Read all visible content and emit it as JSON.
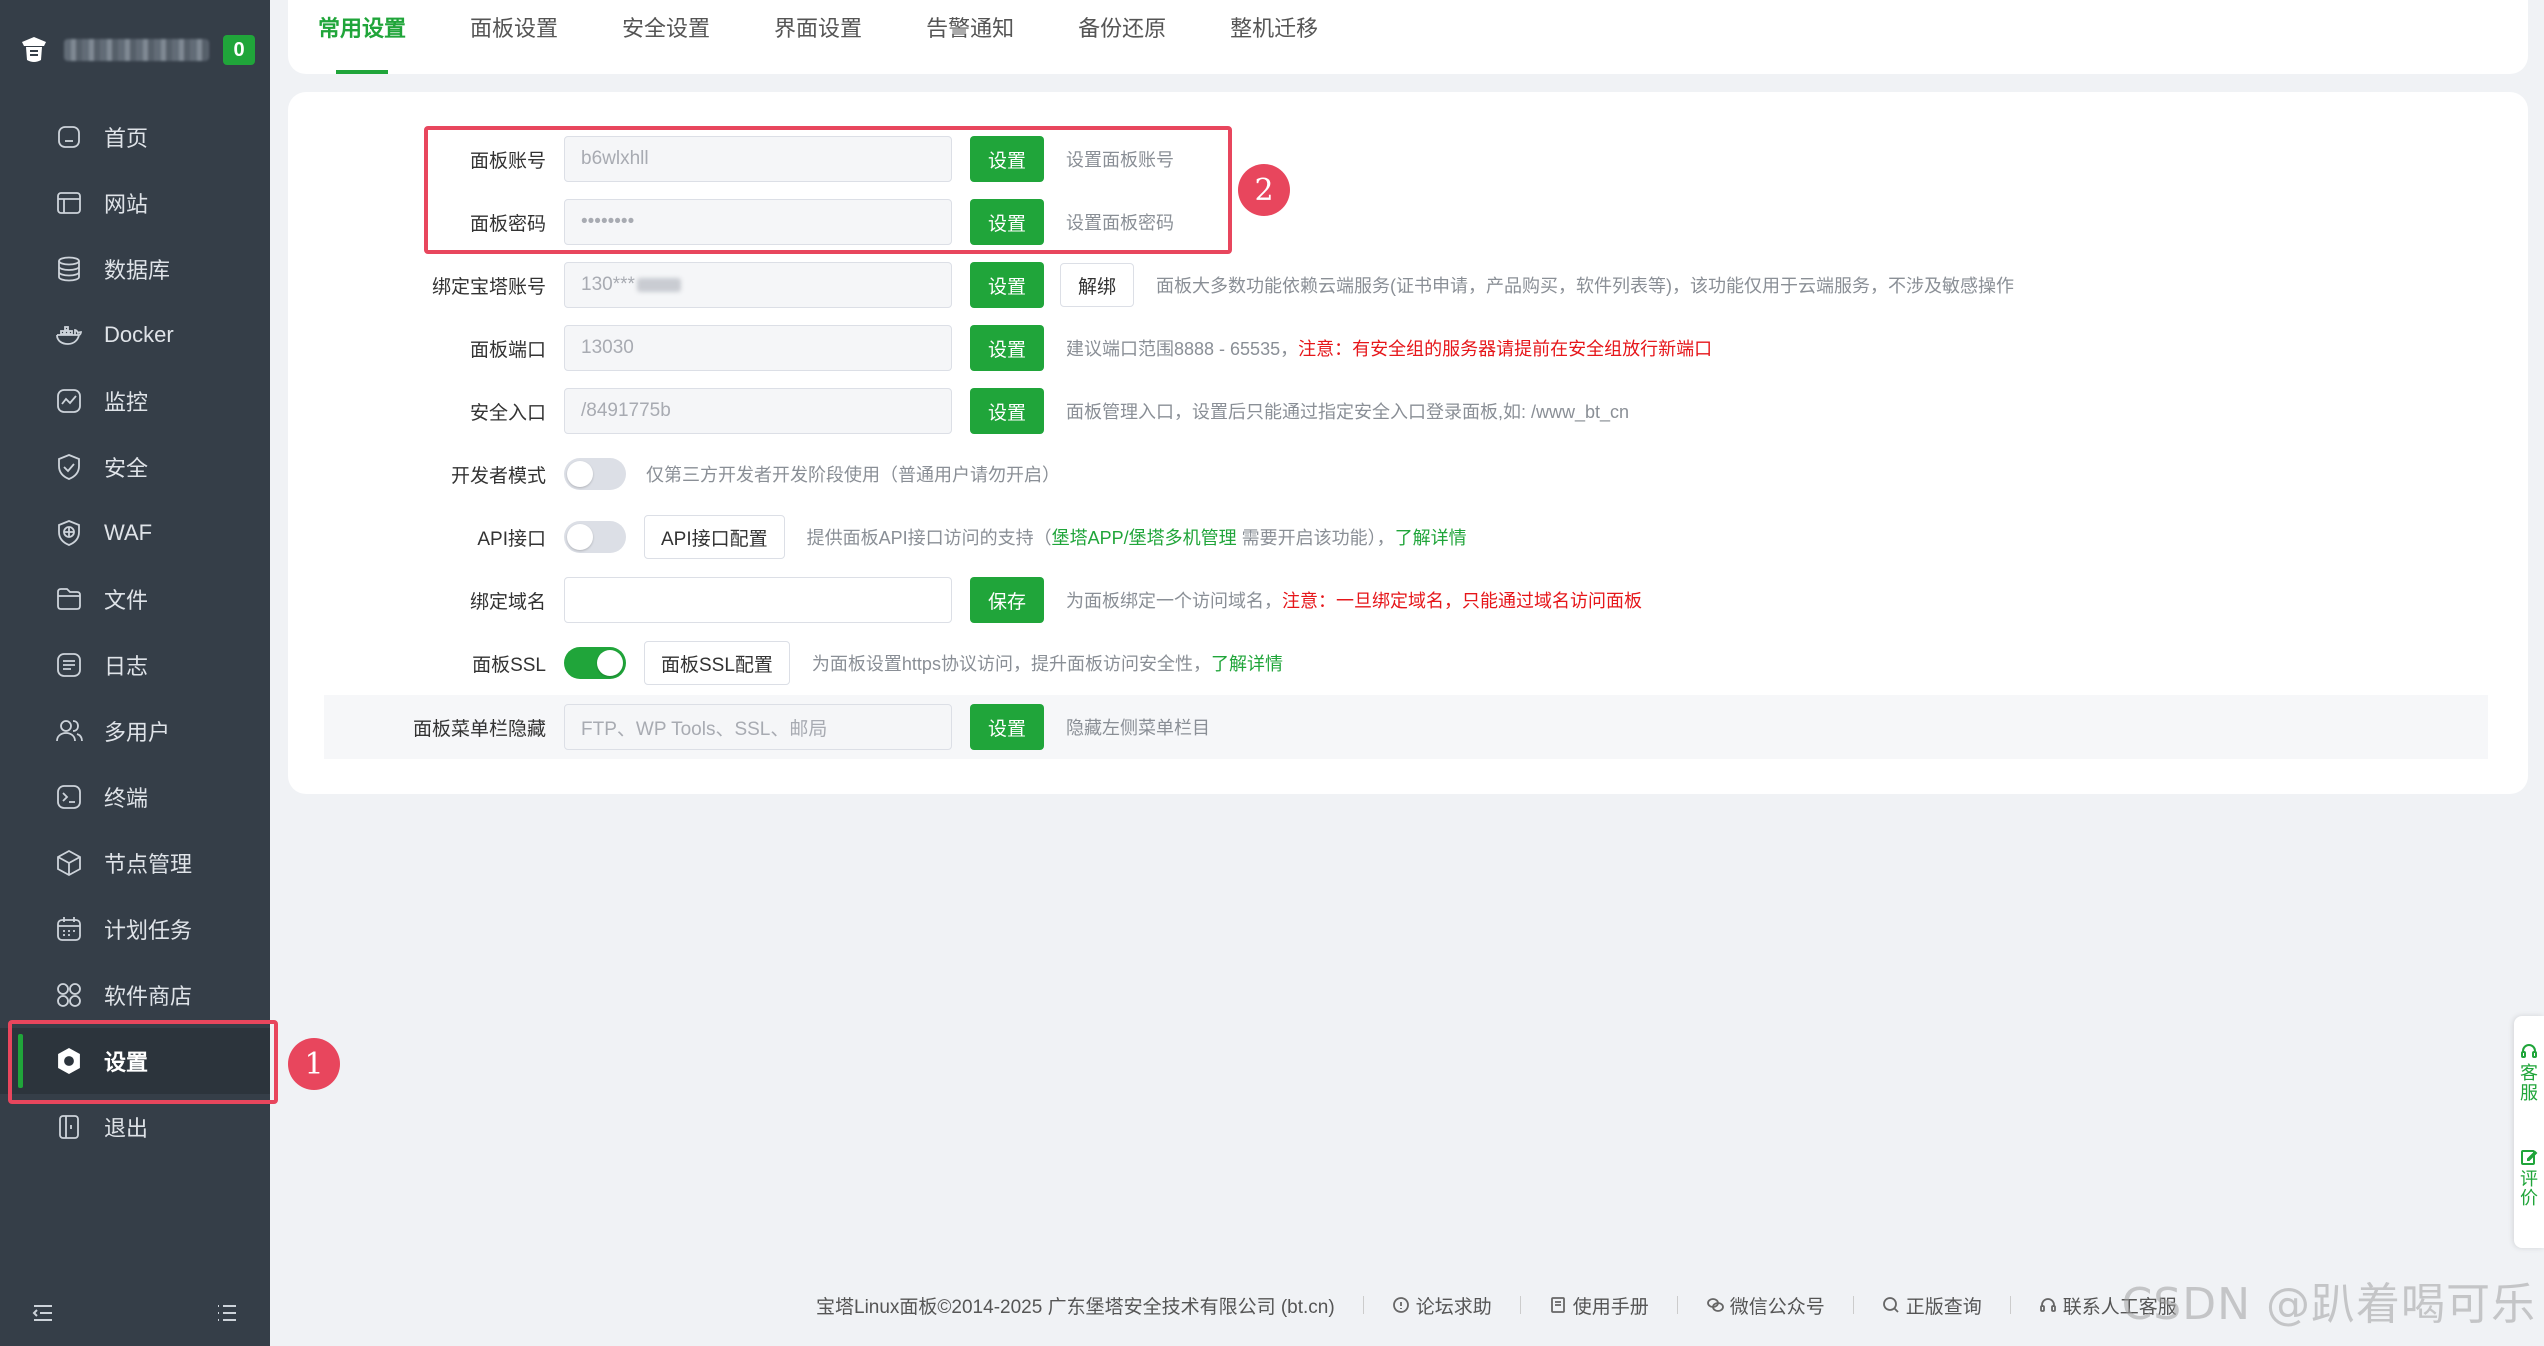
{
  "sidebar": {
    "badge": "0",
    "items": [
      {
        "label": "首页",
        "icon": "home-icon"
      },
      {
        "label": "网站",
        "icon": "website-icon"
      },
      {
        "label": "数据库",
        "icon": "database-icon"
      },
      {
        "label": "Docker",
        "icon": "docker-icon"
      },
      {
        "label": "监控",
        "icon": "monitor-icon"
      },
      {
        "label": "安全",
        "icon": "shield-icon"
      },
      {
        "label": "WAF",
        "icon": "waf-icon"
      },
      {
        "label": "文件",
        "icon": "folder-icon"
      },
      {
        "label": "日志",
        "icon": "log-icon"
      },
      {
        "label": "多用户",
        "icon": "users-icon"
      },
      {
        "label": "终端",
        "icon": "terminal-icon"
      },
      {
        "label": "节点管理",
        "icon": "node-icon"
      },
      {
        "label": "计划任务",
        "icon": "calendar-icon"
      },
      {
        "label": "软件商店",
        "icon": "store-icon"
      },
      {
        "label": "设置",
        "icon": "gear-icon",
        "active": true
      },
      {
        "label": "退出",
        "icon": "logout-icon"
      }
    ]
  },
  "annotations": {
    "one": "1",
    "two": "2"
  },
  "tabs": [
    "常用设置",
    "面板设置",
    "安全设置",
    "界面设置",
    "告警通知",
    "备份还原",
    "整机迁移"
  ],
  "settings": {
    "account": {
      "label": "面板账号",
      "value": "b6wlxhll",
      "button": "设置",
      "hint": "设置面板账号"
    },
    "password": {
      "label": "面板密码",
      "value": "••••••••",
      "button": "设置",
      "hint": "设置面板密码"
    },
    "bind": {
      "label": "绑定宝塔账号",
      "value": "130***",
      "button": "设置",
      "unbind": "解绑",
      "hint": "面板大多数功能依赖云端服务(证书申请，产品购买，软件列表等)，该功能仅用于云端服务，不涉及敏感操作"
    },
    "port": {
      "label": "面板端口",
      "value": "13030",
      "button": "设置",
      "hint": "建议端口范围8888 - 65535，",
      "hint_red": "注意：有安全组的服务器请提前在安全组放行新端口"
    },
    "entry": {
      "label": "安全入口",
      "value": "/8491775b",
      "button": "设置",
      "hint": "面板管理入口，设置后只能通过指定安全入口登录面板,如: /www_bt_cn"
    },
    "dev": {
      "label": "开发者模式",
      "hint": "仅第三方开发者开发阶段使用（普通用户请勿开启）",
      "enabled": false
    },
    "api": {
      "label": "API接口",
      "button": "API接口配置",
      "hint_pre": "提供面板API接口访问的支持（",
      "link1": "堡塔APP/",
      "link2": "堡塔多机管理",
      "hint_mid": " 需要开启该功能），",
      "link3": "了解详情",
      "enabled": false
    },
    "domain": {
      "label": "绑定域名",
      "value": "",
      "button": "保存",
      "hint": "为面板绑定一个访问域名，",
      "hint_red": "注意：一旦绑定域名，只能通过域名访问面板"
    },
    "ssl": {
      "label": "面板SSL",
      "button": "面板SSL配置",
      "hint": "为面板设置https协议访问，提升面板访问安全性，",
      "link": "了解详情",
      "enabled": true
    },
    "menu_hide": {
      "label": "面板菜单栏隐藏",
      "placeholder": "FTP、WP Tools、SSL、邮局",
      "button": "设置",
      "hint": "隐藏左侧菜单栏目"
    }
  },
  "footer": {
    "copyright": "宝塔Linux面板©2014-2025 广东堡塔安全技术有限公司 (bt.cn)",
    "links": [
      "论坛求助",
      "使用手册",
      "微信公众号",
      "正版查询",
      "联系人工客服"
    ]
  },
  "float": {
    "service": "客服",
    "review": "评价"
  },
  "watermark": "CSDN @趴着喝可乐",
  "colors": {
    "accent": "#20a53a",
    "sidebar": "#353e48",
    "annotation": "#e8465d",
    "warning": "#e6161a"
  }
}
